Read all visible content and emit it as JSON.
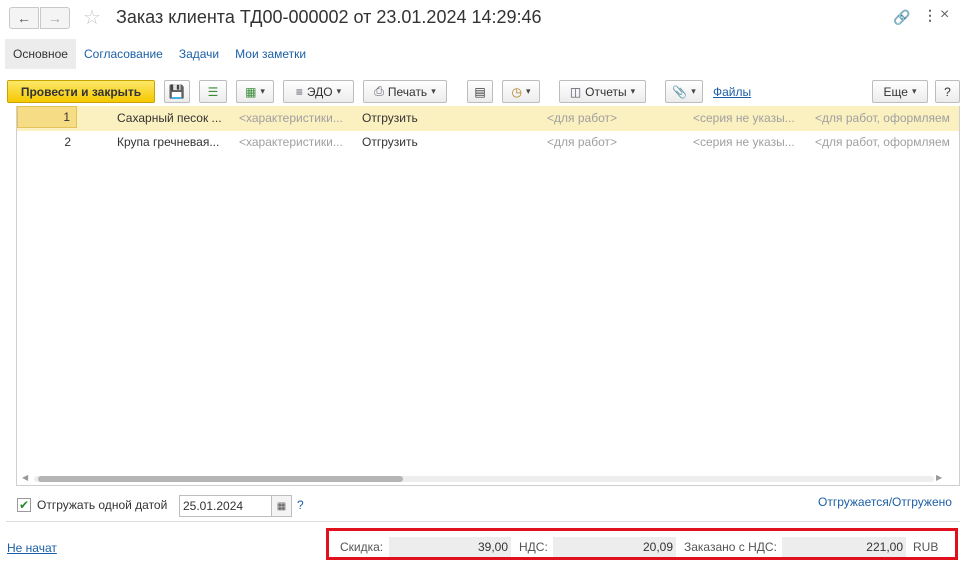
{
  "header": {
    "title": "Заказ клиента ТД00-000002 от 23.01.2024 14:29:46",
    "icons": [
      "back-arrow-icon",
      "forward-arrow-icon",
      "star-icon",
      "link-icon",
      "more-icon",
      "close-icon"
    ]
  },
  "tabs": [
    {
      "label": "Основное"
    },
    {
      "label": "Согласование"
    },
    {
      "label": "Задачи"
    },
    {
      "label": "Мои заметки"
    }
  ],
  "toolbar": {
    "post_close": "Провести и закрыть",
    "edo": "ЭДО",
    "print": "Печать",
    "reports": "Отчеты",
    "files": "Файлы",
    "more": "Еще",
    "help": "?"
  },
  "table": {
    "rows": [
      {
        "num": "1",
        "name": "Сахарный песок ...",
        "char": "<характеристики...",
        "action": "Отгрузить",
        "work": "<для работ>",
        "series": "<серия не указы...",
        "doc": "<для работ, оформляем"
      },
      {
        "num": "2",
        "name": "Крупа гречневая...",
        "char": "<характеристики...",
        "action": "Отгрузить",
        "work": "<для работ>",
        "series": "<серия не указы...",
        "doc": "<для работ, оформляем"
      }
    ]
  },
  "footer": {
    "ship_one_date_label": "Отгружать одной датой",
    "ship_date": "25.01.2024",
    "help": "?",
    "shipping_link": "Отгружается/Отгружено",
    "status": "Не начат",
    "discount_label": "Скидка:",
    "discount_value": "39,00",
    "vat_label": "НДС:",
    "vat_value": "20,09",
    "ordered_label": "Заказано с НДС:",
    "ordered_value": "221,00",
    "currency": "RUB"
  },
  "colors": {
    "primary_button": "#f5c800",
    "link": "#1c5fa6",
    "highlight_box": "#e0101c",
    "selected_row": "#fbf0c0"
  }
}
